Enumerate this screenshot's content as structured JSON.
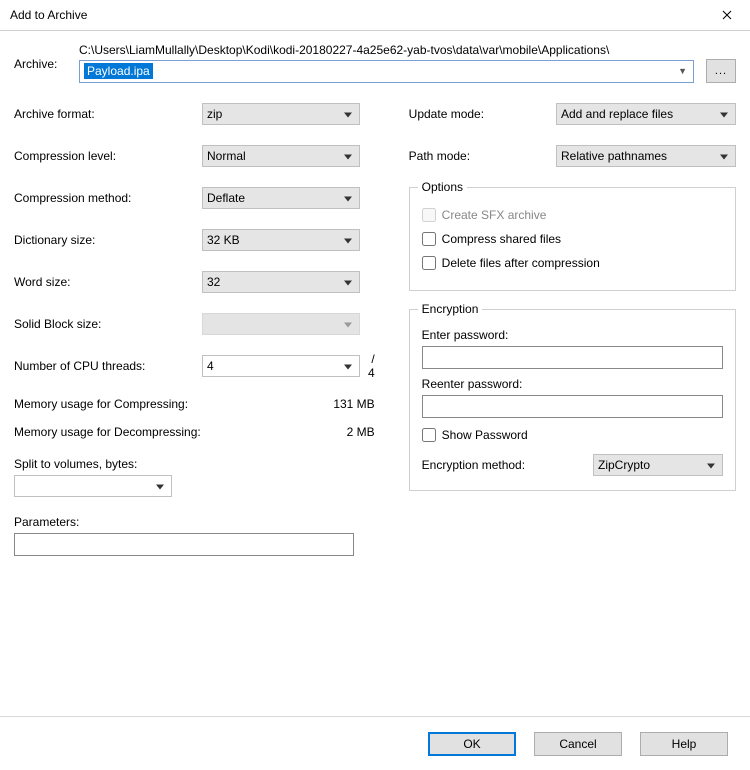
{
  "title": "Add to Archive",
  "archive": {
    "label": "Archive:",
    "path": "C:\\Users\\LiamMullally\\Desktop\\Kodi\\kodi-20180227-4a25e62-yab-tvos\\data\\var\\mobile\\Applications\\",
    "filename": "Payload.ipa",
    "browse": "..."
  },
  "left": {
    "format": {
      "label": "Archive format:",
      "value": "zip"
    },
    "level": {
      "label": "Compression level:",
      "value": "Normal"
    },
    "method": {
      "label": "Compression method:",
      "value": "Deflate"
    },
    "dict": {
      "label": "Dictionary size:",
      "value": "32 KB"
    },
    "word": {
      "label": "Word size:",
      "value": "32"
    },
    "solid": {
      "label": "Solid Block size:",
      "value": ""
    },
    "cpu": {
      "label": "Number of CPU threads:",
      "value": "4",
      "total": "/ 4"
    },
    "mem_compress": {
      "label": "Memory usage for Compressing:",
      "value": "131 MB"
    },
    "mem_decompress": {
      "label": "Memory usage for Decompressing:",
      "value": "2 MB"
    },
    "split": {
      "label": "Split to volumes, bytes:",
      "value": ""
    },
    "params": {
      "label": "Parameters:",
      "value": ""
    }
  },
  "right": {
    "update": {
      "label": "Update mode:",
      "value": "Add and replace files"
    },
    "pathmode": {
      "label": "Path mode:",
      "value": "Relative pathnames"
    },
    "options": {
      "legend": "Options",
      "sfx": "Create SFX archive",
      "shared": "Compress shared files",
      "delete": "Delete files after compression"
    },
    "encryption": {
      "legend": "Encryption",
      "enter": "Enter password:",
      "reenter": "Reenter password:",
      "show": "Show Password",
      "method_label": "Encryption method:",
      "method_value": "ZipCrypto"
    }
  },
  "buttons": {
    "ok": "OK",
    "cancel": "Cancel",
    "help": "Help"
  }
}
